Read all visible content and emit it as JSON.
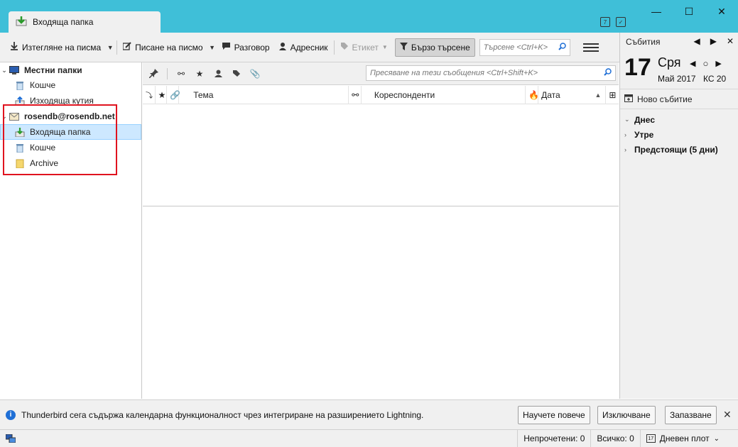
{
  "tab": {
    "title": "Входяща папка"
  },
  "toolbar": {
    "get_mail": "Изтегляне на писма",
    "write": "Писане на писмо",
    "chat": "Разговор",
    "address_book": "Адресник",
    "tag": "Етикет",
    "quick_filter": "Бързо търсене",
    "search_placeholder": "Търсене <Ctrl+K>"
  },
  "folders": {
    "local_folders": "Местни папки",
    "local_trash": "Кошче",
    "local_outbox": "Изходяща кутия",
    "account": "rosendb@rosendb.net",
    "inbox": "Входяща папка",
    "trash": "Кошче",
    "archive": "Archive"
  },
  "thread": {
    "filter_placeholder": "Пресяване на тези съобщения <Ctrl+Shift+K>",
    "col_subject": "Тема",
    "col_correspondents": "Кореспонденти",
    "col_date": "Дата"
  },
  "today_pane": {
    "title": "Събития",
    "day": "17",
    "weekday": "Сря",
    "month_year": "Май 2017",
    "week": "КС 20",
    "new_event": "Ново събитие",
    "agenda": [
      "Днес",
      "Утре",
      "Предстоящи (5 дни)"
    ]
  },
  "notification": {
    "message": "Thunderbird сега съдържа календарна функционалност чрез интегриране на разширението Lightning.",
    "learn_more": "Научете повече",
    "disable": "Изключване",
    "keep": "Запазване"
  },
  "statusbar": {
    "unread": "Непрочетени: 0",
    "total": "Всичко: 0",
    "day_pane": "Дневен плот"
  },
  "colors": {
    "titlebar": "#3fbfd8",
    "selection": "#cde8ff",
    "highlight_box": "#e0131f",
    "info": "#1f6fd6"
  }
}
